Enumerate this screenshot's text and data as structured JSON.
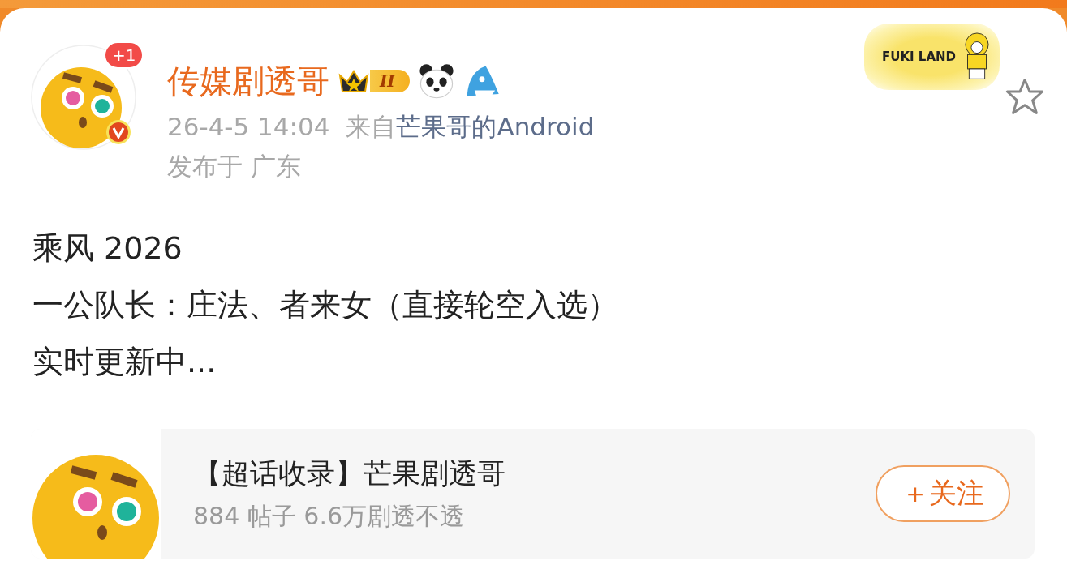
{
  "user": {
    "name": "传媒剧透哥",
    "badge_level": "II",
    "notification_count": "+1",
    "verified": true
  },
  "sticker": {
    "text": "FUKI LAND"
  },
  "favorite": {
    "selected": false
  },
  "meta": {
    "time": "26-4-5 14:04",
    "source_prefix": "来自",
    "source": "芒果哥的Android",
    "location": "发布于 广东"
  },
  "post": {
    "lines": [
      "乘风 2026",
      "一公队长：庄法、者来女（直接轮空入选）",
      "实时更新中..."
    ]
  },
  "topic_card": {
    "title": "【超话收录】芒果剧透哥",
    "stats": "884 帖子  6.6万剧透不透",
    "follow_button": "＋关注"
  }
}
